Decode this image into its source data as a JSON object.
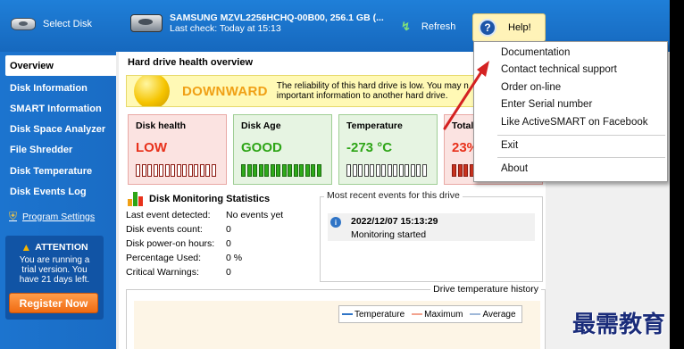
{
  "topbar": {
    "select_disk_label": "Select Disk",
    "disk_model": "SAMSUNG MZVL2256HCHQ-00B00, 256.1 GB (...",
    "last_check": "Last check: Today at 15:13",
    "refresh_label": "Refresh",
    "help_label": "Help!"
  },
  "sidebar": {
    "items": [
      {
        "label": "Overview",
        "active": true
      },
      {
        "label": "Disk Information"
      },
      {
        "label": "SMART Information"
      },
      {
        "label": "Disk Space Analyzer"
      },
      {
        "label": "File Shredder"
      },
      {
        "label": "Disk Temperature"
      },
      {
        "label": "Disk Events Log"
      }
    ],
    "program_settings": "Program Settings",
    "attention_title": "ATTENTION",
    "attention_text": "You are running a trial version. You have 21 days left.",
    "register_label": "Register Now"
  },
  "main": {
    "section_title": "Hard drive health overview",
    "alert_status": "DOWNWARD",
    "alert_message_line1": "The reliability of this hard drive is low. You may n",
    "alert_message_line2": "important information to another hard drive.",
    "cards": [
      {
        "label": "Disk health",
        "value": "LOW"
      },
      {
        "label": "Disk Age",
        "value": "GOOD"
      },
      {
        "label": "Temperature",
        "value": "-273 °C"
      },
      {
        "label": "Total",
        "value": "23%"
      }
    ],
    "stats_title": "Disk Monitoring Statistics",
    "stats": [
      {
        "label": "Last event detected:",
        "value": "No events yet"
      },
      {
        "label": "Disk events count:",
        "value": "0"
      },
      {
        "label": "Disk power-on hours:",
        "value": "0"
      },
      {
        "label": "Percentage Used:",
        "value": "0 %"
      },
      {
        "label": "Critical Warnings:",
        "value": "0"
      }
    ],
    "events_title": "Most recent events for this drive",
    "event": {
      "date": "2022/12/07 15:13:29",
      "message": "Monitoring started"
    },
    "temp_history_title": "Drive temperature history",
    "legend": [
      "Temperature",
      "Maximum",
      "Average"
    ]
  },
  "help_menu": {
    "items": [
      "Documentation",
      "Contact technical support",
      "Order on-line",
      "Enter Serial number",
      "Like ActiveSMART on Facebook",
      "Exit",
      "About"
    ]
  },
  "watermark": "最需教育",
  "colors": {
    "header_blue": "#1a71c9",
    "status_orange": "#f0a015",
    "bad_red": "#e8311b",
    "good_green": "#2ea517"
  }
}
